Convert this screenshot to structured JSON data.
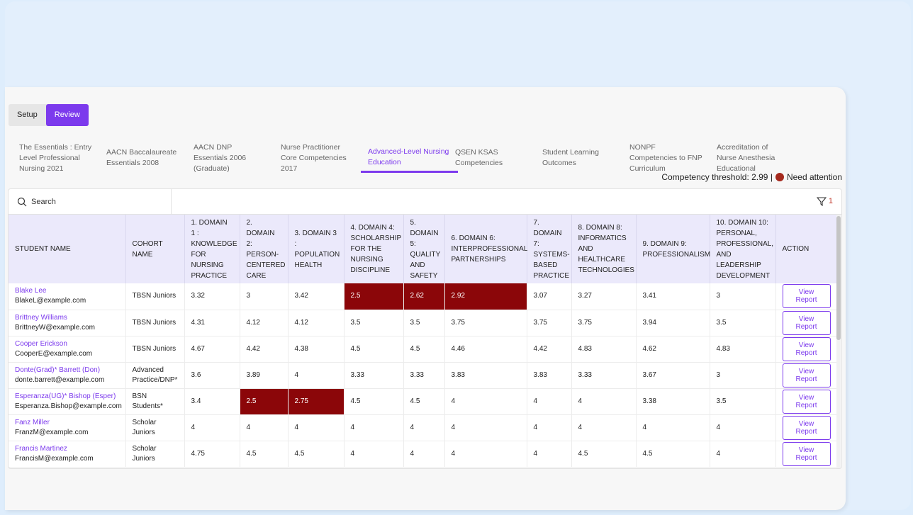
{
  "mode_buttons": [
    "Setup",
    "Review"
  ],
  "tabs": [
    "The Essentials : Entry Level Professional Nursing 2021",
    "AACN Baccalaureate Essentials 2008",
    "AACN DNP Essentials 2006 (Graduate)",
    "Nurse Practitioner Core Competencies 2017",
    "Advanced-Level Nursing Education",
    "QSEN KSAS Competencies",
    "Student Learning Outcomes",
    "NONPF Competencies to FNP Curriculum",
    "Accreditation of Nurse Anesthesia Educational"
  ],
  "active_tab": 4,
  "threshold": {
    "label": "Competency threshold: 2.99 |",
    "legend": "Need attention",
    "color": "#a52a1e",
    "value": 2.99
  },
  "search": {
    "placeholder": "Search"
  },
  "filter": {
    "count": "1"
  },
  "columns": [
    "STUDENT NAME",
    "COHORT NAME",
    "1. DOMAIN 1 : KNOWLEDGE FOR NURSING PRACTICE",
    "2. DOMAIN 2: PERSON-CENTERED CARE",
    "3. DOMAIN 3 : POPULATION HEALTH",
    "4. DOMAIN 4: SCHOLARSHIP FOR THE NURSING DISCIPLINE",
    "5. DOMAIN 5: QUALITY AND SAFETY",
    "6. DOMAIN 6: INTERPROFESSIONAL PARTNERSHIPS",
    "7. DOMAIN 7: SYSTEMS-BASED PRACTICE",
    "8. DOMAIN 8: INFORMATICS AND HEALTHCARE TECHNOLOGIES",
    "9. DOMAIN 9: PROFESSIONALISM",
    "10. DOMAIN 10: PERSONAL, PROFESSIONAL, AND LEADERSHIP DEVELOPMENT",
    "ACTION"
  ],
  "action_label": "View Report",
  "rows": [
    {
      "name": "Blake Lee",
      "email": "BlakeL@example.com",
      "cohort": "TBSN Juniors",
      "scores": [
        "3.32",
        "3",
        "3.42",
        "2.5",
        "2.62",
        "2.92",
        "3.07",
        "3.27",
        "3.41",
        "3"
      ]
    },
    {
      "name": "Brittney Williams",
      "email": "BrittneyW@example.com",
      "cohort": "TBSN Juniors",
      "scores": [
        "4.31",
        "4.12",
        "4.12",
        "3.5",
        "3.5",
        "3.75",
        "3.75",
        "3.75",
        "3.94",
        "3.5"
      ]
    },
    {
      "name": "Cooper Erickson",
      "email": "CooperE@example.com",
      "cohort": "TBSN Juniors",
      "scores": [
        "4.67",
        "4.42",
        "4.38",
        "4.5",
        "4.5",
        "4.46",
        "4.42",
        "4.83",
        "4.62",
        "4.83"
      ]
    },
    {
      "name": "Donte(Grad)* Barrett (Don)",
      "email": "donte.barrett@example.com",
      "cohort": "Advanced Practice/DNP*",
      "scores": [
        "3.6",
        "3.89",
        "4",
        "3.33",
        "3.33",
        "3.83",
        "3.83",
        "3.33",
        "3.67",
        "3"
      ]
    },
    {
      "name": "Esperanza(UG)* Bishop (Esper)",
      "email": "Esperanza.Bishop@example.com",
      "cohort": "BSN Students*",
      "scores": [
        "3.4",
        "2.5",
        "2.75",
        "4.5",
        "4.5",
        "4",
        "4",
        "4",
        "3.38",
        "3.5"
      ]
    },
    {
      "name": "Fanz Miller",
      "email": "FranzM@example.com",
      "cohort": "Scholar Juniors",
      "scores": [
        "4",
        "4",
        "4",
        "4",
        "4",
        "4",
        "4",
        "4",
        "4",
        "4"
      ]
    },
    {
      "name": "Francis Martinez",
      "email": "FrancisM@example.com",
      "cohort": "Scholar Juniors",
      "scores": [
        "4.75",
        "4.5",
        "4.5",
        "4",
        "4",
        "4",
        "4",
        "4.5",
        "4.5",
        "4"
      ]
    }
  ]
}
